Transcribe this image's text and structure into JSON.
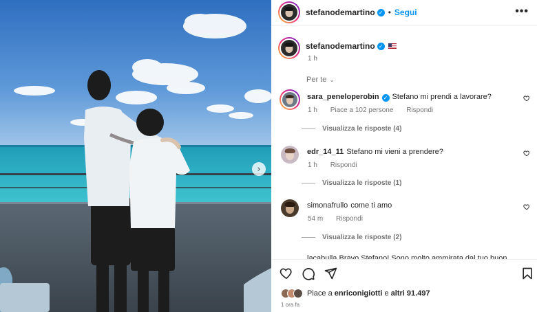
{
  "post": {
    "username": "stefanodemartino",
    "follow_label": "Segui",
    "dot": "•",
    "more_label": "•••",
    "caption_time": "1 h",
    "next_label": "›"
  },
  "sort": {
    "label": "Per te",
    "chevron": "⌄"
  },
  "comments": [
    {
      "user": "sara_peneloperobin",
      "text": "Stefano mi prendi a lavorare?",
      "time": "1 h",
      "likes": "Piace a 102 persone",
      "reply": "Rispondi",
      "replies": "Visualizza le risposte (4)"
    },
    {
      "user": "edr_14_11",
      "text": "Stefano mi vieni a prendere?",
      "time": "1 h",
      "reply": "Rispondi",
      "replies": "Visualizza le risposte (1)"
    },
    {
      "user": "simonafrullo",
      "text": "come ti amo",
      "time": "54 m",
      "reply": "Rispondi",
      "replies": "Visualizza le risposte (2)"
    }
  ],
  "partial_comment": "lacabulla  Bravo Stefano! Sono molto ammirata dal tuo buon",
  "footer": {
    "liked_by_prefix": "Piace a",
    "liked_by_user": "enriconigiotti",
    "and_others_prefix": "e",
    "others": "altri 91.497",
    "posted_ago": "1 ora fa"
  },
  "icons": {
    "verified": "verified-badge-icon",
    "flag": "us-flag-icon",
    "like": "heart-icon",
    "comment": "comment-icon",
    "share": "share-icon",
    "save": "bookmark-icon"
  },
  "colors": {
    "accent": "#0095f6",
    "muted": "#737373",
    "text": "#262626"
  }
}
